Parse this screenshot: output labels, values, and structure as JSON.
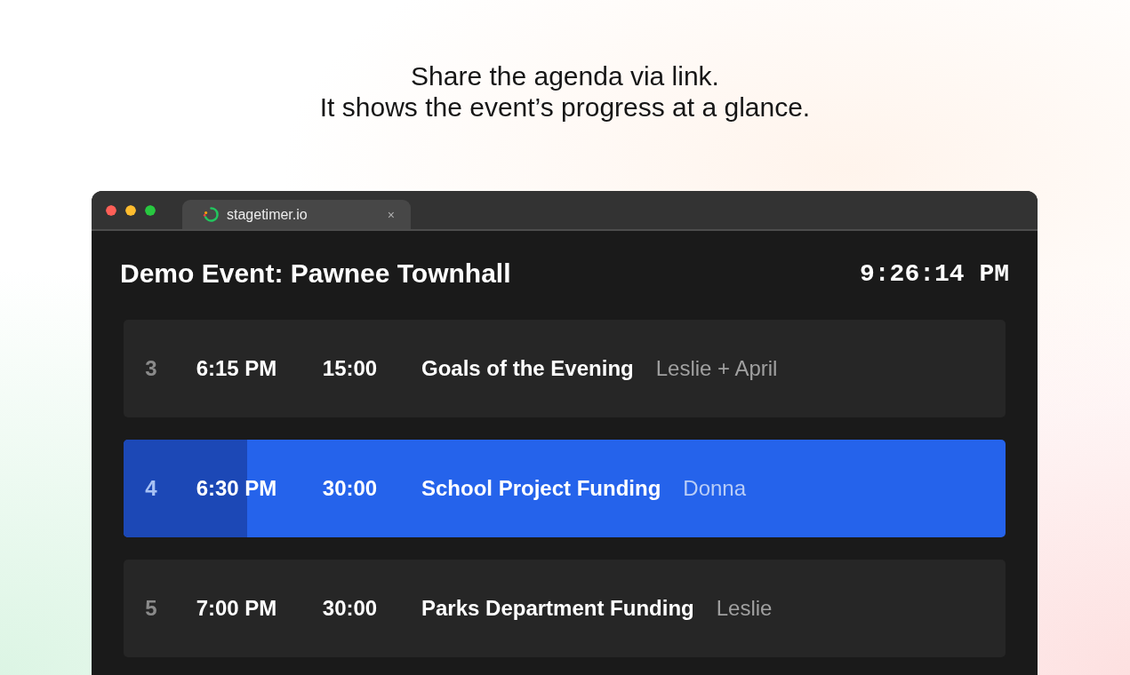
{
  "caption": {
    "lines": [
      "Share the agenda via link.",
      "It shows the event’s progress at a glance."
    ]
  },
  "browser": {
    "tab": {
      "title": "stagetimer.io",
      "close": "×",
      "selected": true
    }
  },
  "app": {
    "title": "Demo Event: Pawnee Townhall",
    "clock": "9:26:14 PM"
  },
  "agenda": [
    {
      "number": "3",
      "start": "6:15 PM",
      "duration": "15:00",
      "title": "Goals of the Evening",
      "speaker": "Leslie + April",
      "current": false
    },
    {
      "number": "4",
      "start": "6:30 PM",
      "duration": "30:00",
      "title": "School Project Funding",
      "speaker": "Donna",
      "current": true,
      "level": 0.14
    },
    {
      "number": "5",
      "start": "7:00 PM",
      "duration": "30:00",
      "title": "Parks Department Funding",
      "speaker": "Leslie",
      "current": false
    }
  ]
}
